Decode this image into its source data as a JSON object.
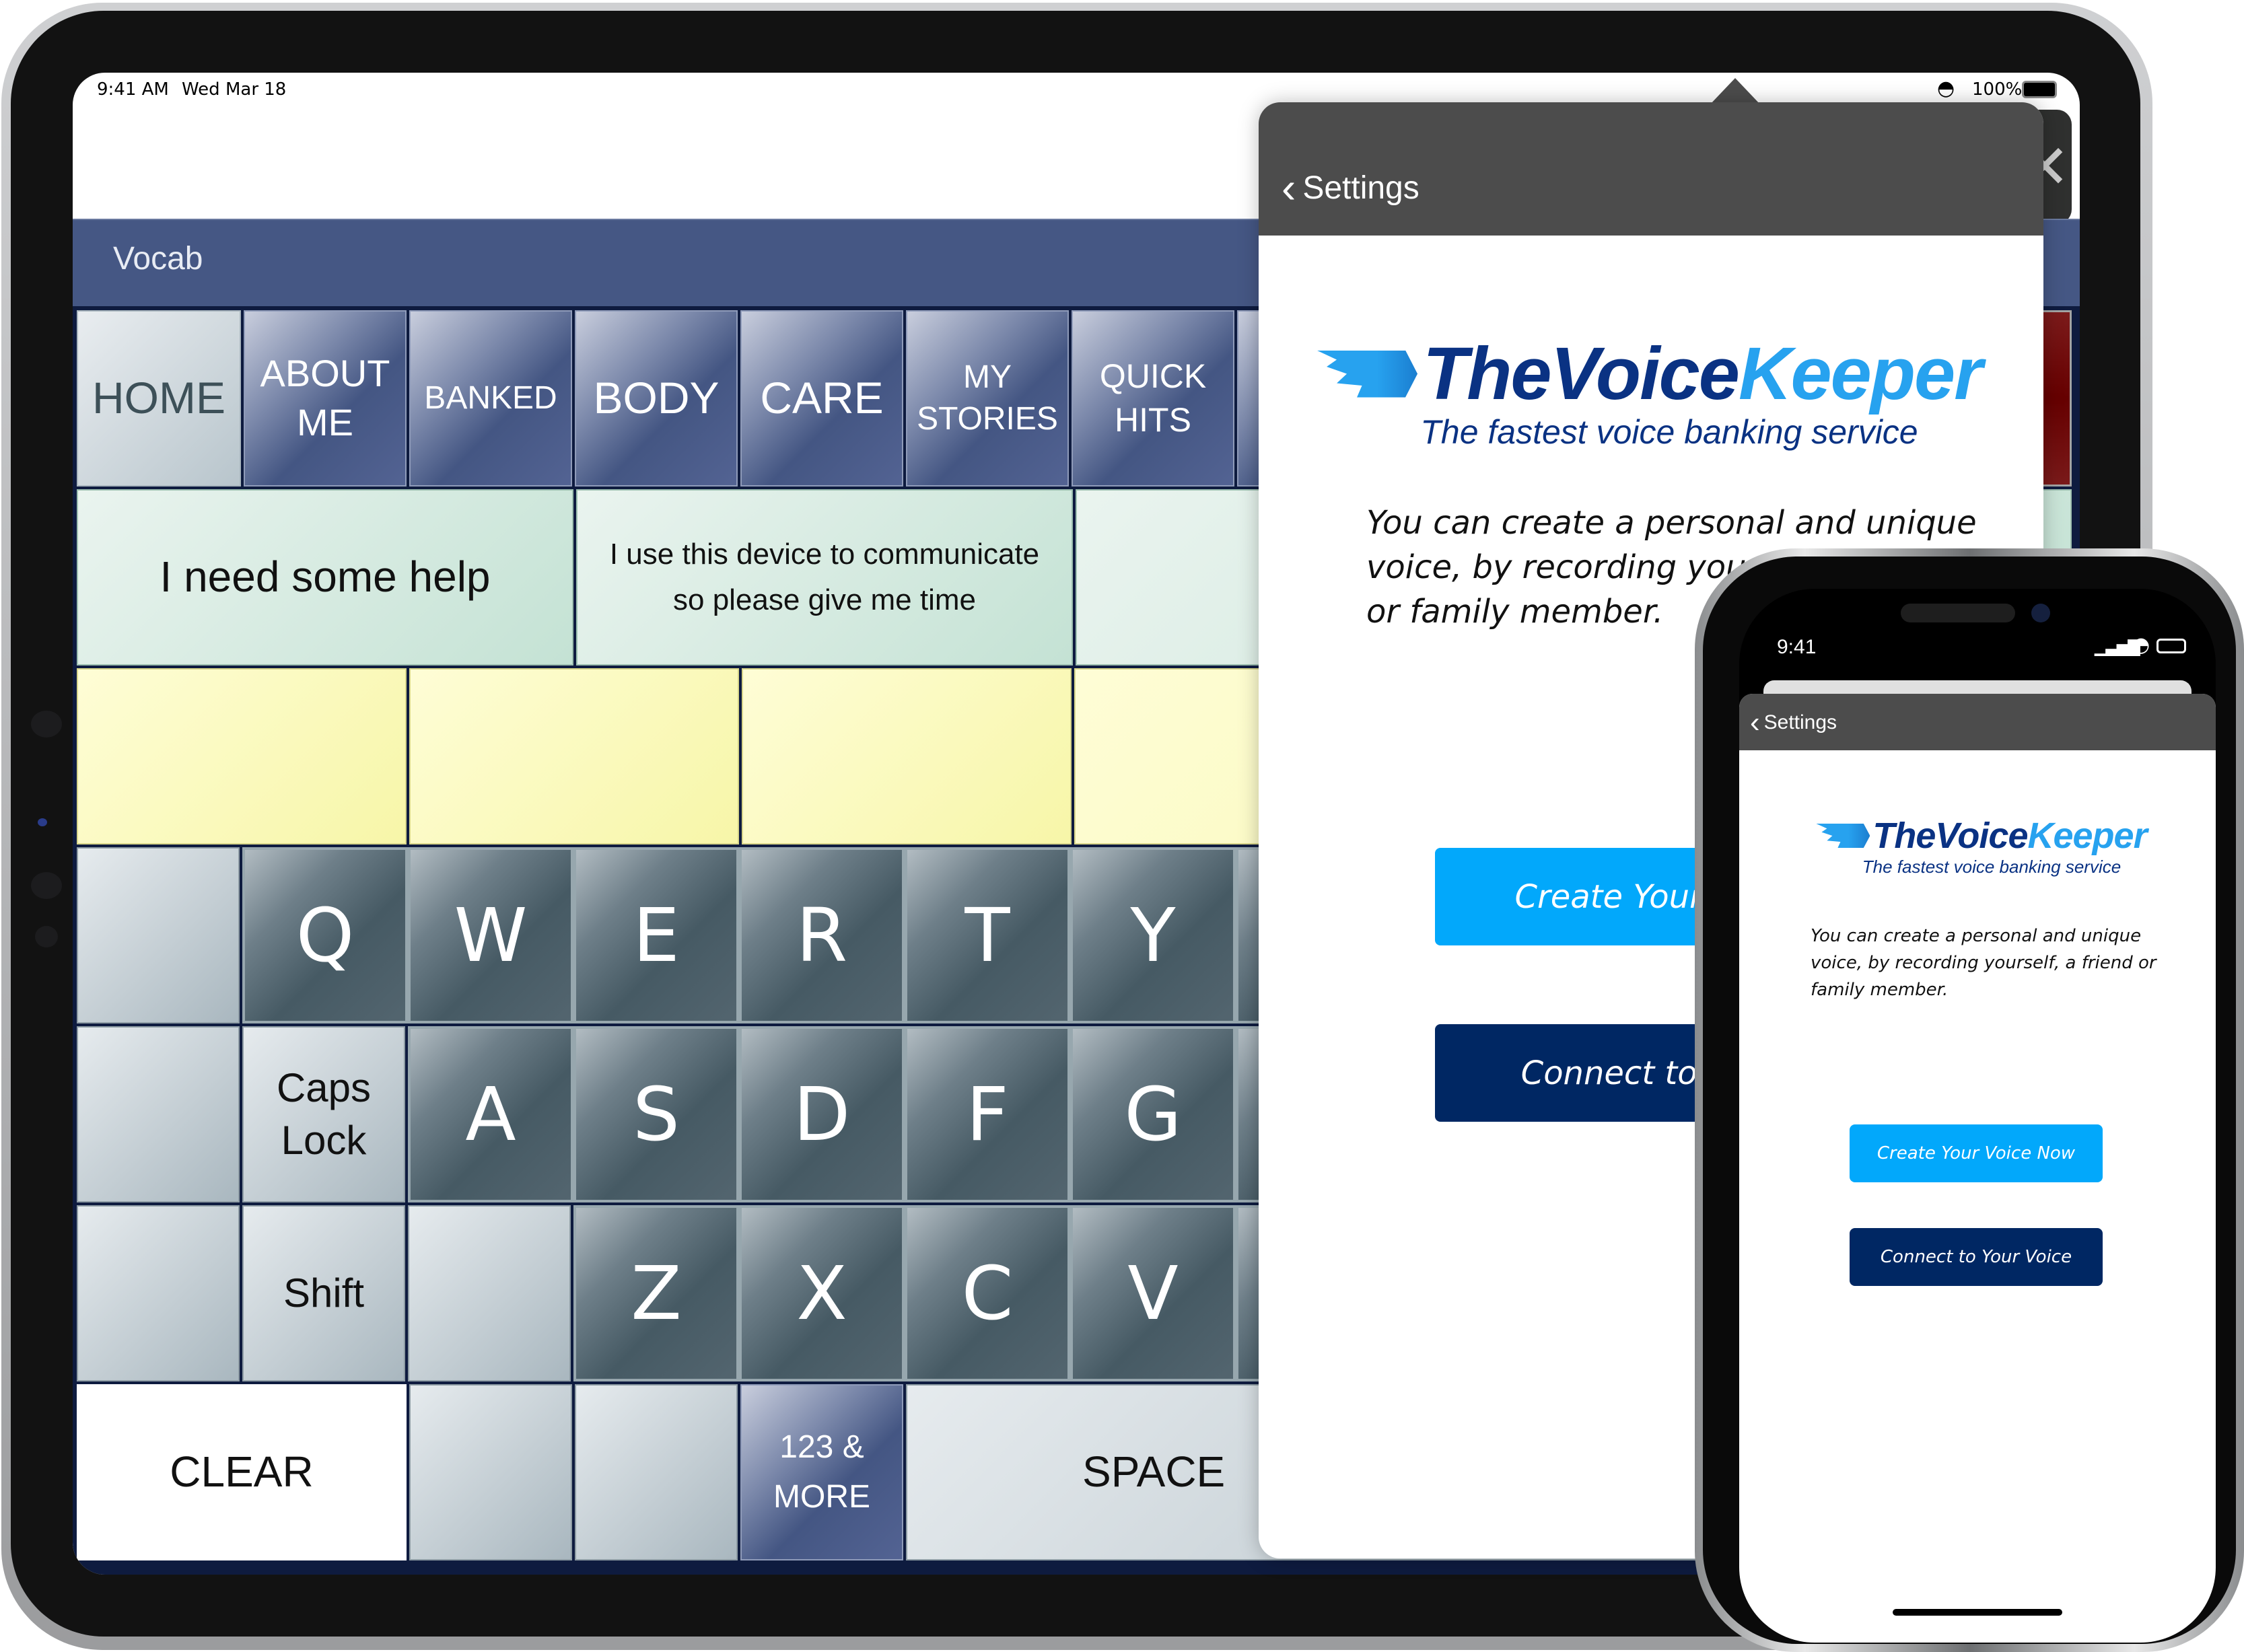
{
  "ipad": {
    "status": {
      "time": "9:41 AM",
      "date": "Wed Mar 18",
      "battery": "100%"
    },
    "vocab_title": "Vocab",
    "nav_tiles": [
      "HOME",
      "ABOUT ME",
      "BANKED",
      "BODY",
      "CARE",
      "MY STORIES",
      "QUICK HITS"
    ],
    "phrases": [
      "I need some help",
      "I use this device to communicate so please give me time"
    ],
    "keyboard": {
      "row1": [
        "Q",
        "W",
        "E",
        "R",
        "T",
        "Y"
      ],
      "row2_label": "Caps Lock",
      "row2": [
        "A",
        "S",
        "D",
        "F",
        "G"
      ],
      "row3_label": "Shift",
      "row3": [
        "Z",
        "X",
        "C",
        "V"
      ],
      "clear": "CLEAR",
      "more": "123 & MORE",
      "space": "SPACE"
    },
    "popover": {
      "back_label": "Settings",
      "logo": {
        "the": "The",
        "voice": "Voice",
        "keeper": "Keeper",
        "tagline": "The fastest voice banking service"
      },
      "description": "You can create a personal and unique voice, by recording yourself, a friend or family member.",
      "create_button": "Create Your Voice Now",
      "connect_button": "Connect to Your Voice"
    }
  },
  "iphone": {
    "status": {
      "time": "9:41"
    },
    "back_label": "Settings",
    "logo": {
      "the": "The",
      "voice": "Voice",
      "keeper": "Keeper",
      "tagline": "The fastest voice banking service"
    },
    "description": "You can create a personal and unique voice, by recording yourself, a friend or family member.",
    "create_button": "Create Your Voice Now",
    "connect_button": "Connect to Your Voice"
  },
  "colors": {
    "accent_light_blue": "#02a8fb",
    "accent_navy": "#002763",
    "vocab_bar": "#455784",
    "stop_red": "#660000"
  }
}
